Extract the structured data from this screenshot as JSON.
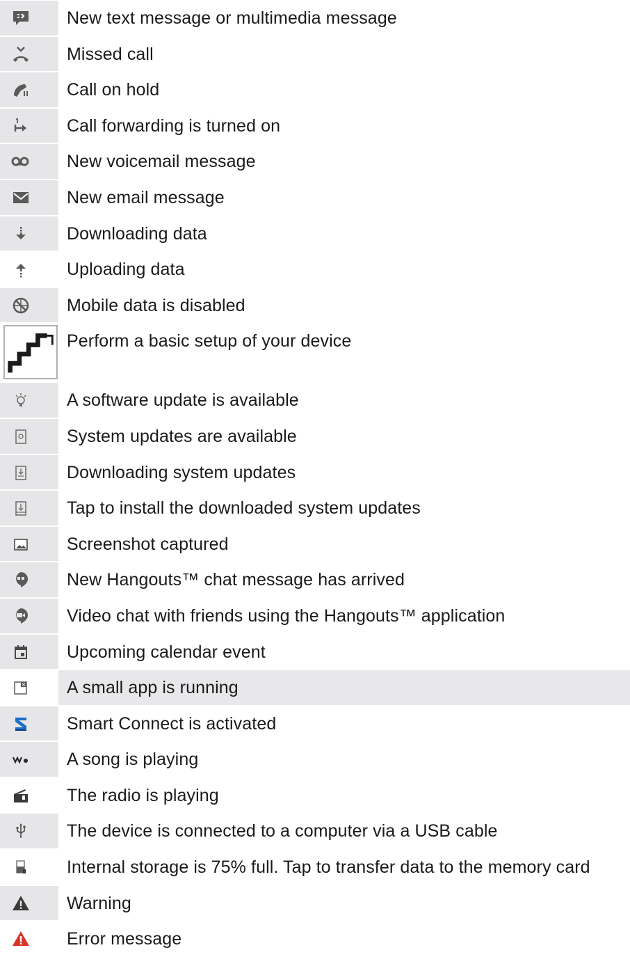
{
  "icons_list": [
    {
      "label": "New text message or multimedia message",
      "icon": "sms-message-icon"
    },
    {
      "label": "Missed call",
      "icon": "missed-call-icon"
    },
    {
      "label": "Call on hold",
      "icon": "call-on-hold-icon"
    },
    {
      "label": "Call forwarding is turned on",
      "icon": "call-forwarding-icon"
    },
    {
      "label": "New voicemail message",
      "icon": "voicemail-icon"
    },
    {
      "label": "New email message",
      "icon": "email-icon"
    },
    {
      "label": "Downloading data",
      "icon": "download-icon"
    },
    {
      "label": "Uploading data",
      "icon": "upload-icon"
    },
    {
      "label": "Mobile data is disabled",
      "icon": "mobile-data-disabled-icon"
    },
    {
      "label": "Perform a basic setup of your device",
      "icon": "setup-stairs-icon"
    },
    {
      "label": "A software update is available",
      "icon": "lightbulb-icon"
    },
    {
      "label": "System updates are available",
      "icon": "system-update-icon"
    },
    {
      "label": "Downloading system updates",
      "icon": "downloading-system-update-icon"
    },
    {
      "label": "Tap to install the downloaded system updates",
      "icon": "install-update-icon"
    },
    {
      "label": "Screenshot captured",
      "icon": "screenshot-icon"
    },
    {
      "label": "New Hangouts™ chat message has arrived",
      "icon": "hangouts-chat-icon"
    },
    {
      "label": "Video chat with friends using the Hangouts™ application",
      "icon": "hangouts-video-icon"
    },
    {
      "label": "Upcoming calendar event",
      "icon": "calendar-icon"
    },
    {
      "label": "A small app is running",
      "icon": "small-app-icon"
    },
    {
      "label": "Smart Connect is activated",
      "icon": "smart-connect-icon"
    },
    {
      "label": "A song is playing",
      "icon": "walkman-icon"
    },
    {
      "label": "The radio is playing",
      "icon": "radio-icon"
    },
    {
      "label": "The device is connected to a computer via a USB cable",
      "icon": "usb-icon"
    },
    {
      "label": "Internal storage is 75% full. Tap to transfer data to the memory card",
      "icon": "storage-icon"
    },
    {
      "label": "Warning",
      "icon": "warning-icon"
    },
    {
      "label": "Error message",
      "icon": "error-icon"
    }
  ],
  "colors": {
    "icon_cell_bg": "#e6e6e8",
    "icon_gray": "#5a5a5a",
    "smart_connect_blue": "#1a6ec8",
    "error_red": "#d9332a",
    "highlight_row": "#e8e8ea"
  }
}
